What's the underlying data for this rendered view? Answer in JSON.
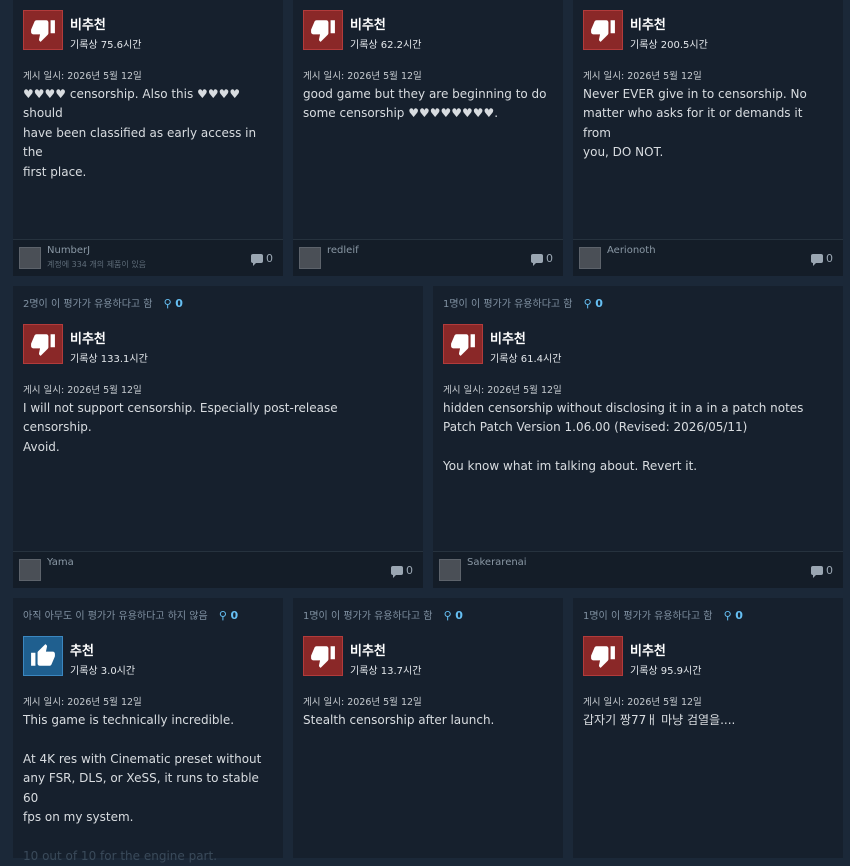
{
  "reviews": [
    {
      "helpful_text": "",
      "award_count": "",
      "verdict": "비추천",
      "recommended": false,
      "hours": "기록상 75.6시간",
      "posted": "게시 일시: 2026년 5월 12일",
      "body": [
        "♥♥♥♥ censorship. Also this ♥♥♥♥ should",
        "have been classified as early access in the",
        "first place."
      ],
      "username": "NumberJ",
      "games_owned": "계정에 334 개의 제품이 있음",
      "comments": "0"
    },
    {
      "helpful_text": "",
      "award_count": "",
      "verdict": "비추천",
      "recommended": false,
      "hours": "기록상 62.2시간",
      "posted": "게시 일시: 2026년 5월 12일",
      "body": [
        "good game but they are beginning to do",
        "some censorship ♥♥♥♥♥♥♥♥."
      ],
      "username": "redleif",
      "games_owned": "",
      "comments": "0"
    },
    {
      "helpful_text": "",
      "award_count": "",
      "verdict": "비추천",
      "recommended": false,
      "hours": "기록상 200.5시간",
      "posted": "게시 일시: 2026년 5월 12일",
      "body": [
        "Never EVER give in to censorship. No",
        "matter who asks for it or demands it from",
        "you, DO NOT."
      ],
      "username": "Aerionoth",
      "games_owned": "",
      "comments": "0"
    },
    {
      "helpful_text": "2명이 이 평가가 유용하다고 함",
      "award_count": "0",
      "verdict": "비추천",
      "recommended": false,
      "hours": "기록상 133.1시간",
      "posted": "게시 일시: 2026년 5월 12일",
      "body": [
        "I will not support censorship. Especially post-release censorship.",
        "Avoid."
      ],
      "username": "Yama",
      "games_owned": "",
      "comments": "0"
    },
    {
      "helpful_text": "1명이 이 평가가 유용하다고 함",
      "award_count": "0",
      "verdict": "비추천",
      "recommended": false,
      "hours": "기록상 61.4시간",
      "posted": "게시 일시: 2026년 5월 12일",
      "body": [
        "hidden censorship without disclosing it in a in a patch notes",
        "Patch Patch Version 1.06.00 (Revised: 2026/05/11)",
        "",
        "You know what im talking about. Revert it."
      ],
      "username": "Sakerarenai",
      "games_owned": "",
      "comments": "0"
    },
    {
      "helpful_text": "아직 아무도 이 평가가 유용하다고 하지 않음",
      "award_count": "0",
      "verdict": "추천",
      "recommended": true,
      "hours": "기록상 3.0시간",
      "posted": "게시 일시: 2026년 5월 12일",
      "body": [
        "This game is technically incredible.",
        "",
        "At 4K res with Cinematic preset without",
        "any FSR, DLS, or XeSS, it runs to stable 60",
        "fps on my system.",
        "",
        "10 out of 10 for the engine part."
      ],
      "username": "",
      "games_owned": "",
      "comments": ""
    },
    {
      "helpful_text": "1명이 이 평가가 유용하다고 함",
      "award_count": "0",
      "verdict": "비추천",
      "recommended": false,
      "hours": "기록상 13.7시간",
      "posted": "게시 일시: 2026년 5월 12일",
      "body": [
        "Stealth censorship after launch."
      ],
      "username": "",
      "games_owned": "",
      "comments": ""
    },
    {
      "helpful_text": "1명이 이 평가가 유용하다고 함",
      "award_count": "0",
      "verdict": "비추천",
      "recommended": false,
      "hours": "기록상 95.9시간",
      "posted": "게시 일시: 2026년 5월 12일",
      "body": [
        "갑자기 짱77ㅐ 마냥 검열을...."
      ],
      "username": "",
      "games_owned": "",
      "comments": ""
    }
  ],
  "colors": {
    "background": "#1b2838",
    "card": "#16202d",
    "negative": "#8a2828",
    "positive": "#1f5f8f",
    "award": "#66c0f4"
  },
  "icons": {
    "negative": "thumbs-down-icon",
    "positive": "thumbs-up-icon",
    "award": "award-icon",
    "comment": "comment-bubble-icon"
  }
}
